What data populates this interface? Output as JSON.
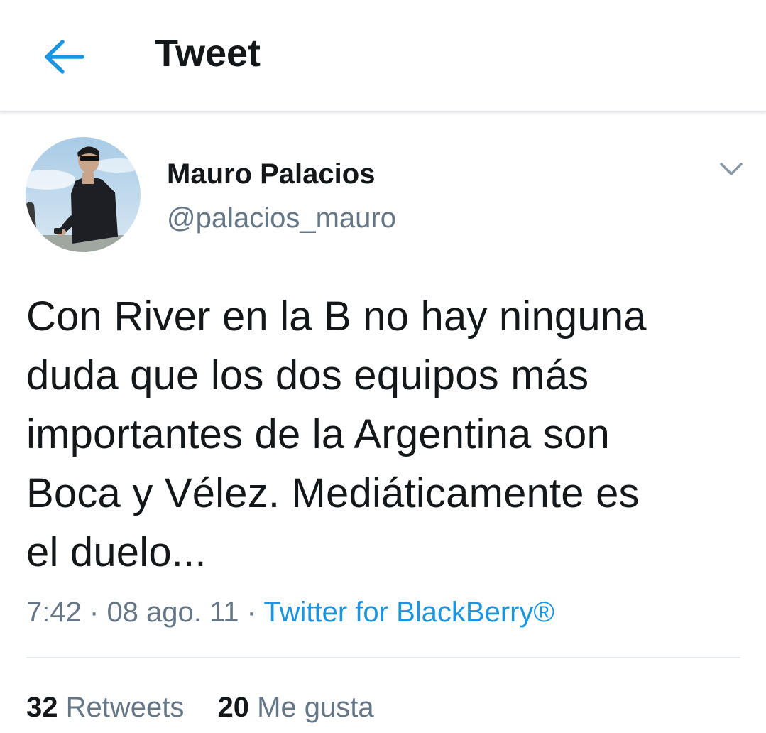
{
  "header": {
    "title": "Tweet",
    "back_icon": "arrow-left-icon"
  },
  "colors": {
    "accent": "#1b95e0",
    "text": "#14171a",
    "secondary": "#657786",
    "divider": "#e1e8ed"
  },
  "tweet": {
    "author": {
      "display_name": "Mauro Palacios",
      "handle": "@palacios_mauro"
    },
    "menu_icon": "chevron-down-icon",
    "lines": [
      "Con River en la B no hay ninguna",
      "duda que los dos equipos más",
      "importantes de la Argentina son",
      "Boca y Vélez. Mediáticamente es",
      "el duelo..."
    ],
    "time": "7:42",
    "date": "08 ago. 11",
    "separator": "·",
    "source": "Twitter for BlackBerry®",
    "stats": {
      "retweets_count": "32",
      "retweets_label": "Retweets",
      "likes_count": "20",
      "likes_label": "Me gusta"
    }
  }
}
